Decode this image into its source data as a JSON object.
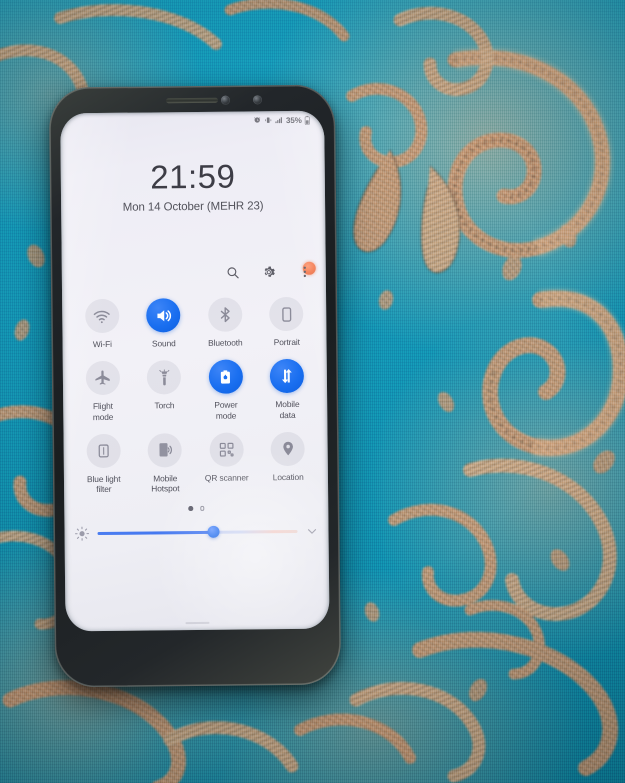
{
  "background": {
    "description": "teal woven fabric with peach paisley embroidery",
    "base_color": "#1496b6",
    "accent_color": "#edb68f"
  },
  "device": {
    "name": "smartphone",
    "body_color": "#1a1e20",
    "earpiece": "earpiece-speaker",
    "front_camera": "front-camera",
    "proximity_sensor": "proximity-sensor"
  },
  "statusbar": {
    "alarm_icon": "alarm-icon",
    "vibrate_icon": "vibrate-icon",
    "signal_icon": "signal-bars-icon",
    "battery_percent": "35%",
    "battery_icon": "battery-icon"
  },
  "clock": {
    "time": "21:59",
    "date": "Mon 14 October (MEHR 23)"
  },
  "actions": [
    {
      "name": "search-icon",
      "label": "Search"
    },
    {
      "name": "settings-gear-icon",
      "label": "Settings"
    },
    {
      "name": "more-options-icon",
      "label": "More options",
      "badge_color": "#f4622d"
    }
  ],
  "quick_settings": {
    "accent_on_color": "#1a6ff0",
    "off_color": "#8b8b99",
    "tiles": [
      {
        "id": "wifi",
        "label": "Wi-Fi",
        "icon": "wifi-icon",
        "state": "off"
      },
      {
        "id": "sound",
        "label": "Sound",
        "icon": "sound-speaker-icon",
        "state": "on"
      },
      {
        "id": "bluetooth",
        "label": "Bluetooth",
        "icon": "bluetooth-icon",
        "state": "off"
      },
      {
        "id": "portrait",
        "label": "Portrait",
        "icon": "rotation-lock-icon",
        "state": "off"
      },
      {
        "id": "flight-mode",
        "label": "Flight\nmode",
        "icon": "airplane-icon",
        "state": "off"
      },
      {
        "id": "torch",
        "label": "Torch",
        "icon": "flashlight-icon",
        "state": "off"
      },
      {
        "id": "power-mode",
        "label": "Power\nmode",
        "icon": "battery-power-icon",
        "state": "on"
      },
      {
        "id": "mobile-data",
        "label": "Mobile\ndata",
        "icon": "data-arrows-icon",
        "state": "on"
      },
      {
        "id": "blue-light",
        "label": "Blue light\nfilter",
        "icon": "blue-light-icon",
        "state": "off"
      },
      {
        "id": "hotspot",
        "label": "Mobile\nHotspot",
        "icon": "hotspot-icon",
        "state": "off"
      },
      {
        "id": "qr-scanner",
        "label": "QR scanner",
        "icon": "qr-code-icon",
        "state": "off"
      },
      {
        "id": "location",
        "label": "Location",
        "icon": "location-pin-icon",
        "state": "off"
      }
    ]
  },
  "pager": {
    "total": 2,
    "current": 1
  },
  "brightness": {
    "icon": "brightness-icon",
    "value_percent": 58,
    "expand_icon": "chevron-down-icon"
  }
}
